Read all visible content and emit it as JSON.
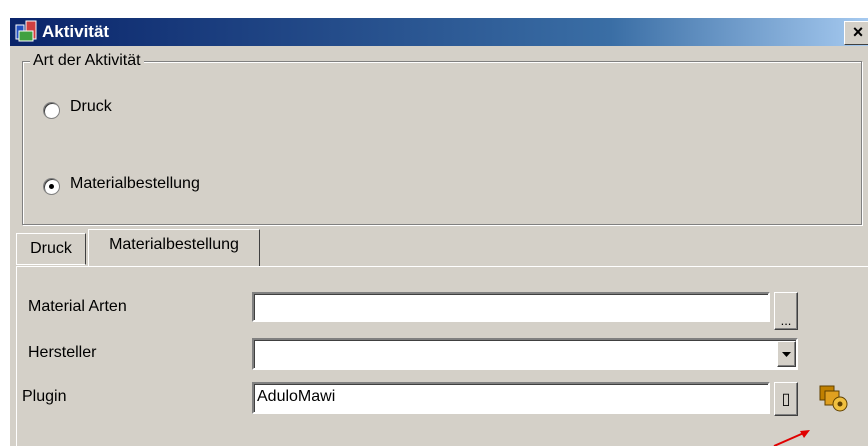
{
  "window": {
    "title": "Aktivität",
    "close_label": "×"
  },
  "group": {
    "legend": "Art der Aktivität",
    "options": [
      {
        "label": "Druck",
        "selected": false
      },
      {
        "label": "Materialbestellung",
        "selected": true
      }
    ]
  },
  "tabs": [
    {
      "label": "Druck",
      "active": false
    },
    {
      "label": "Materialbestellung",
      "active": true
    }
  ],
  "form": {
    "material_arten": {
      "label": "Material Arten",
      "value": "",
      "button_label": "..."
    },
    "hersteller": {
      "label": "Hersteller",
      "value": "",
      "dropdown_icon": "chevron-down-icon"
    },
    "plugin": {
      "label": "Plugin",
      "value": "AduloMawi",
      "button_label": "▯",
      "settings_icon": "plugin-settings-icon"
    }
  },
  "colors": {
    "titlebar_start": "#0a246a",
    "titlebar_end": "#a6caf0",
    "face": "#d4d0c8",
    "annotation_arrow": "#e00000"
  }
}
